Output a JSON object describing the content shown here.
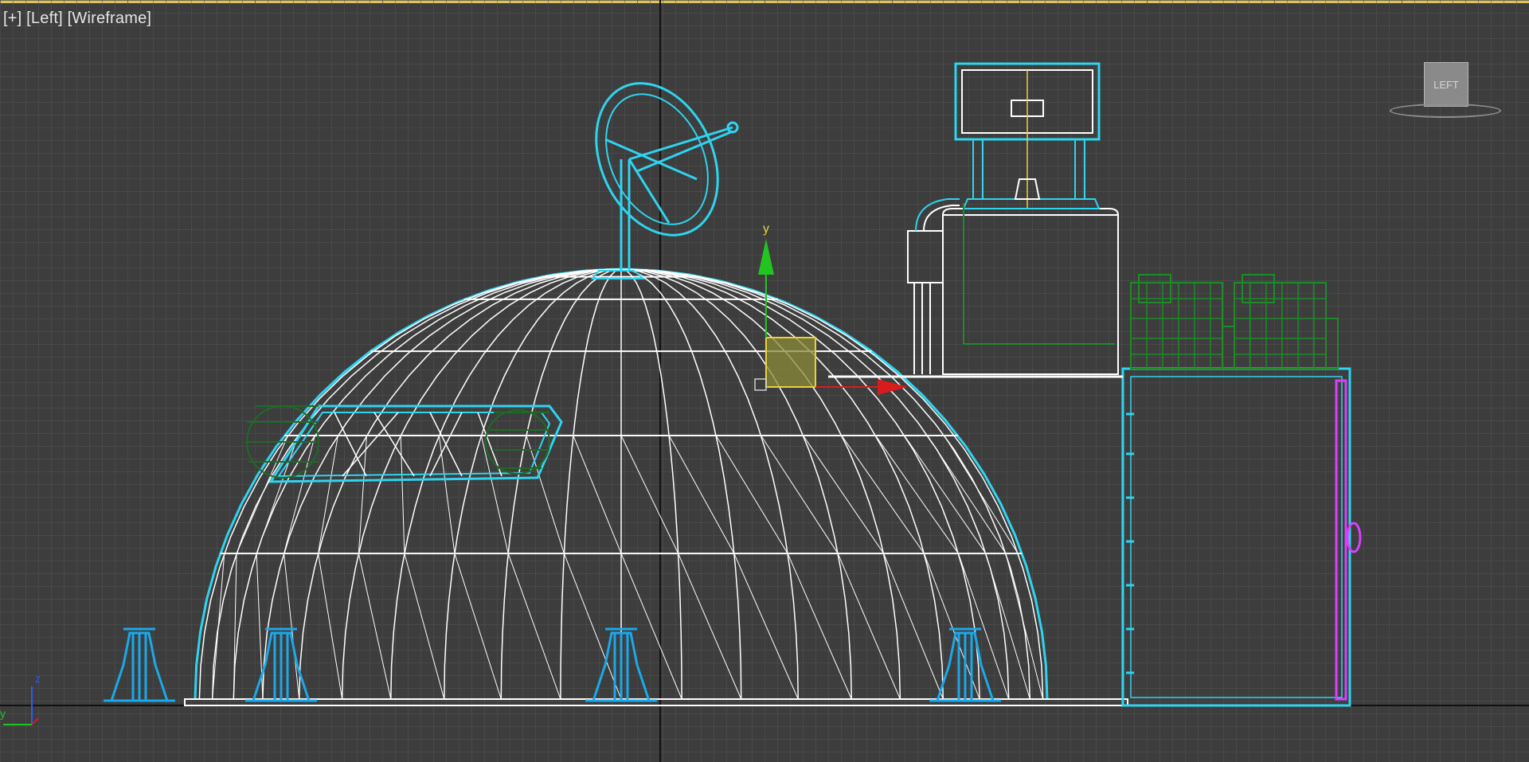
{
  "viewport": {
    "label_plus": "[+]",
    "label_view": "[Left]",
    "label_shading": "[Wireframe]",
    "viewcube_face": "LEFT",
    "gizmo_axis_y": "y",
    "tripod_axis_z": "z",
    "tripod_axis_y": "y"
  },
  "colors": {
    "background": "#3d3d3d",
    "grid": "#5a5a5a",
    "dome_wire": "#ffffff",
    "selection_cyan": "#2fd4f0",
    "tripod_blue": "#1aa9ea",
    "green_objects": "#1f8a2a",
    "dark_green_objects": "#1f6a26",
    "magenta_object": "#d840ff",
    "gizmo_red": "#d81c1c",
    "gizmo_green": "#22c422",
    "gizmo_yellow": "#e8d23a",
    "viewport_border_active": "#e0c35a"
  }
}
